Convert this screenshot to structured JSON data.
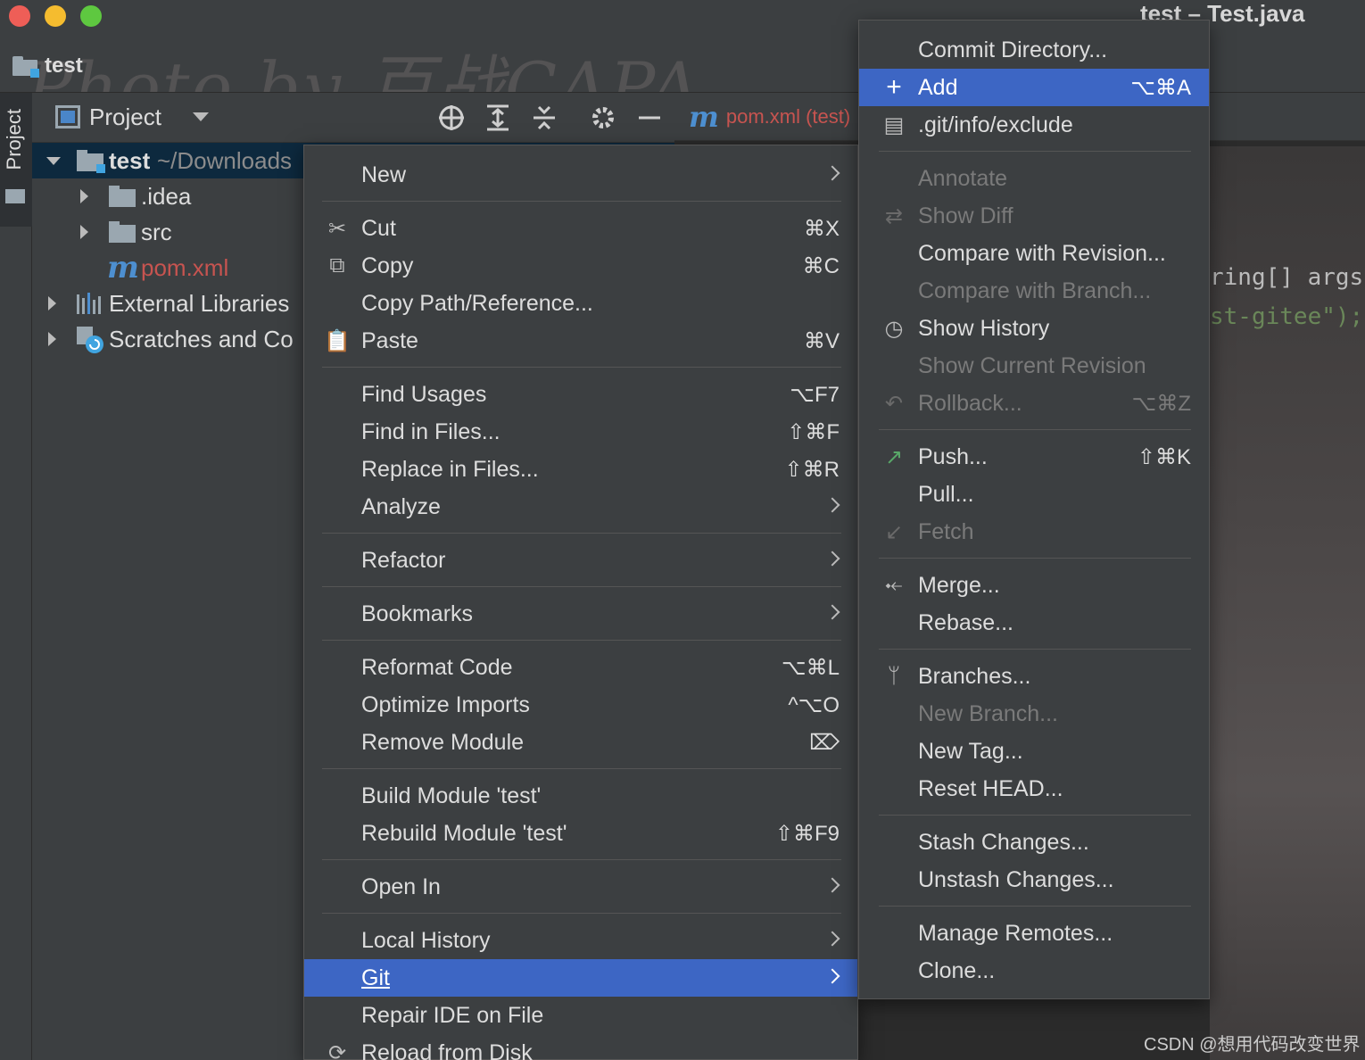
{
  "window": {
    "title": "test – Test.java"
  },
  "navbar": {
    "project_name": "test",
    "watermark": "Photo by 百战CAPA"
  },
  "stripe": {
    "label": "Project"
  },
  "project_panel": {
    "title": "Project",
    "tree": [
      {
        "name": "test",
        "extra": " ~/Downloads",
        "level": 0,
        "expanded": true
      },
      {
        "name": ".idea",
        "level": 1
      },
      {
        "name": "src",
        "level": 1
      },
      {
        "name": "pom.xml",
        "level": 1
      },
      {
        "name": "External Libraries",
        "level": 0
      },
      {
        "name": "Scratches and Co",
        "level": 0
      }
    ]
  },
  "editor": {
    "tab_label": "pom.xml (test)",
    "code_fragments": [
      "ring[] args)",
      "st-gitee\");"
    ]
  },
  "context_menu": {
    "items": [
      {
        "label": "New",
        "shortcut": "",
        "submenu": true
      },
      {
        "label": "Cut",
        "shortcut": "⌘X",
        "icon": "scissors-icon"
      },
      {
        "label": "Copy",
        "shortcut": "⌘C",
        "icon": "copy-icon"
      },
      {
        "label": "Copy Path/Reference...",
        "shortcut": ""
      },
      {
        "label": "Paste",
        "shortcut": "⌘V",
        "icon": "paste-icon"
      },
      {
        "label": "Find Usages",
        "shortcut": "⌥F7"
      },
      {
        "label": "Find in Files...",
        "shortcut": "⇧⌘F"
      },
      {
        "label": "Replace in Files...",
        "shortcut": "⇧⌘R"
      },
      {
        "label": "Analyze",
        "submenu": true
      },
      {
        "label": "Refactor",
        "submenu": true
      },
      {
        "label": "Bookmarks",
        "submenu": true
      },
      {
        "label": "Reformat Code",
        "shortcut": "⌥⌘L"
      },
      {
        "label": "Optimize Imports",
        "shortcut": "^⌥O"
      },
      {
        "label": "Remove Module",
        "shortcut": "⌦"
      },
      {
        "label": "Build Module 'test'",
        "shortcut": ""
      },
      {
        "label": "Rebuild Module 'test'",
        "shortcut": "⇧⌘F9"
      },
      {
        "label": "Open In",
        "submenu": true
      },
      {
        "label": "Local History",
        "submenu": true
      },
      {
        "label": "Git",
        "submenu": true,
        "highlighted": true
      },
      {
        "label": "Repair IDE on File",
        "shortcut": ""
      },
      {
        "label": "Reload from Disk",
        "shortcut": "",
        "icon": "reload-icon"
      }
    ]
  },
  "git_submenu": {
    "items": [
      {
        "label": "Commit Directory...",
        "shortcut": ""
      },
      {
        "label": "Add",
        "shortcut": "⌥⌘A",
        "icon": "plus-icon",
        "highlighted": true
      },
      {
        "label": ".git/info/exclude",
        "shortcut": "",
        "icon": "ignore-file-icon"
      },
      {
        "label": "Annotate",
        "disabled": true
      },
      {
        "label": "Show Diff",
        "disabled": true,
        "icon": "diff-icon"
      },
      {
        "label": "Compare with Revision..."
      },
      {
        "label": "Compare with Branch...",
        "disabled": true
      },
      {
        "label": "Show History",
        "icon": "clock-icon"
      },
      {
        "label": "Show Current Revision",
        "disabled": true
      },
      {
        "label": "Rollback...",
        "shortcut": "⌥⌘Z",
        "disabled": true,
        "icon": "undo-icon"
      },
      {
        "label": "Push...",
        "shortcut": "⇧⌘K",
        "icon": "push-arrow-icon"
      },
      {
        "label": "Pull..."
      },
      {
        "label": "Fetch",
        "disabled": true,
        "icon": "fetch-icon"
      },
      {
        "label": "Merge...",
        "icon": "merge-icon"
      },
      {
        "label": "Rebase..."
      },
      {
        "label": "Branches...",
        "icon": "branch-icon"
      },
      {
        "label": "New Branch...",
        "disabled": true
      },
      {
        "label": "New Tag..."
      },
      {
        "label": "Reset HEAD..."
      },
      {
        "label": "Stash Changes..."
      },
      {
        "label": "Unstash Changes..."
      },
      {
        "label": "Manage Remotes..."
      },
      {
        "label": "Clone..."
      }
    ]
  },
  "footer_watermark": "CSDN @想用代码改变世界",
  "colors": {
    "highlight": "#3d66c4",
    "background": "#3c3f41",
    "disabled": "#7a7a7a",
    "modified_file": "#c75450"
  }
}
